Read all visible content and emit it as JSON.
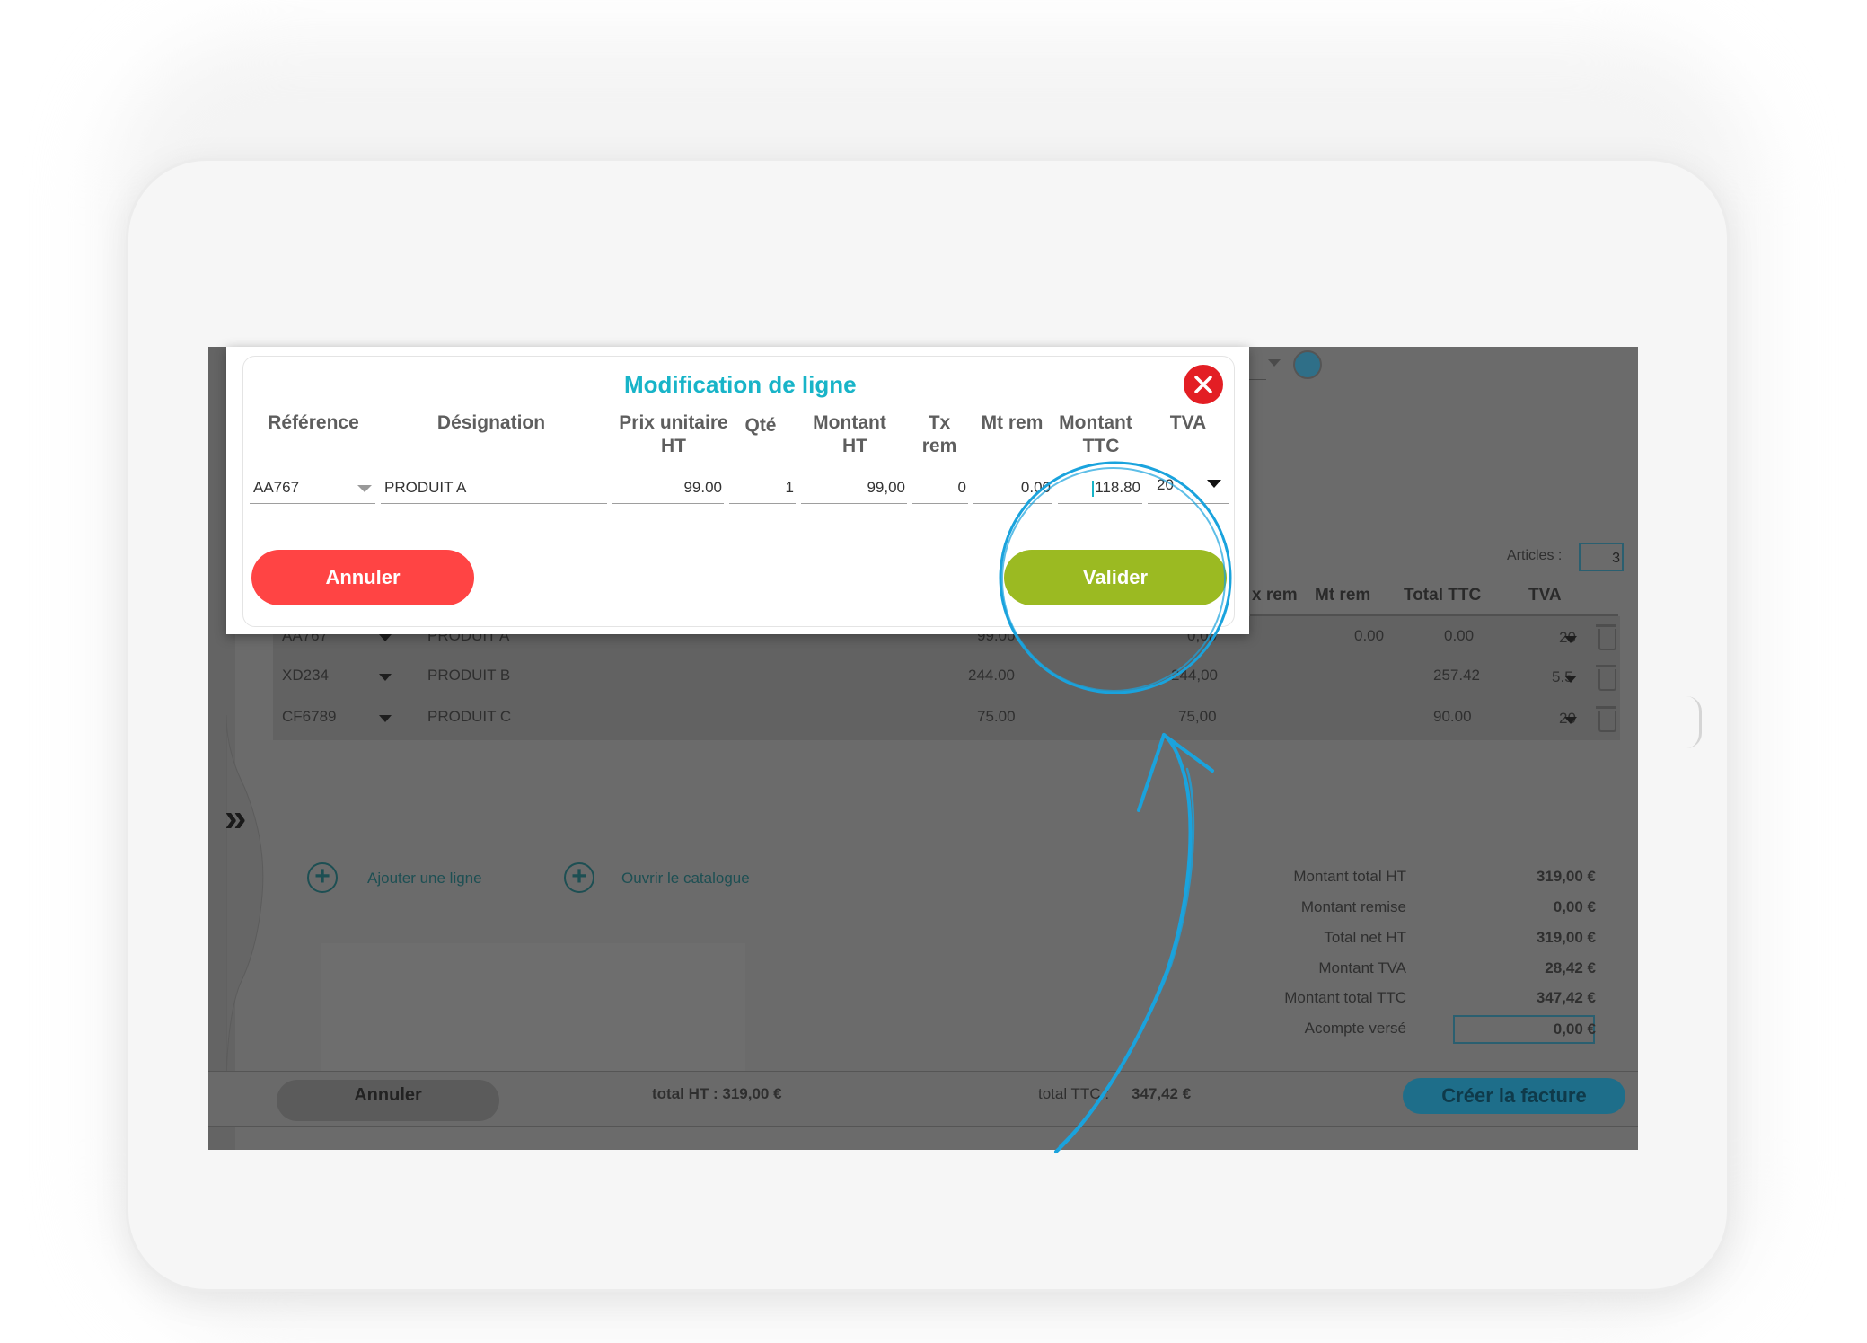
{
  "modal": {
    "title": "Modification de ligne",
    "headers": {
      "reference": "Référence",
      "designation": "Désignation",
      "prix_line1": "Prix unitaire",
      "prix_line2": "HT",
      "qte": "Qté",
      "montant_ht_line1": "Montant",
      "montant_ht_line2": "HT",
      "tx_rem_line1": "Tx",
      "tx_rem_line2": "rem",
      "mt_rem": "Mt rem",
      "montant_ttc_line1": "Montant",
      "montant_ttc_line2": "TTC",
      "tva": "TVA"
    },
    "row": {
      "reference": "AA767",
      "designation": "PRODUIT A",
      "prix": "99.00",
      "qte": "1",
      "montant_ht": "99,00",
      "tx_rem": "0",
      "mt_rem": "0.00",
      "montant_ttc": "118.80",
      "tva": "20"
    },
    "cancel_label": "Annuler",
    "validate_label": "Valider"
  },
  "background": {
    "articles_label": "Articles :",
    "articles_count": "3",
    "headers": {
      "tx_rem": "x rem",
      "mt_rem": "Mt rem",
      "total_ttc": "Total TTC",
      "tva": "TVA"
    },
    "rows": [
      {
        "reference": "AA767",
        "designation": "PRODUIT A",
        "prix": "99.00",
        "montant": "0,00",
        "mt_rem": "0.00",
        "total_ttc": "0.00",
        "tva": "20"
      },
      {
        "reference": "XD234",
        "designation": "PRODUIT B",
        "prix": "244.00",
        "montant": "244,00",
        "mt_rem": "",
        "total_ttc": "257.42",
        "tva": "5.5"
      },
      {
        "reference": "CF6789",
        "designation": "PRODUIT C",
        "prix": "75.00",
        "montant": "75,00",
        "mt_rem": "",
        "total_ttc": "90.00",
        "tva": "20"
      }
    ],
    "add_line_label": "Ajouter une ligne",
    "open_catalog_label": "Ouvrir le catalogue",
    "totals": [
      {
        "label": "Montant total HT",
        "value": "319,00 €"
      },
      {
        "label": "Montant remise",
        "value": "0,00 €"
      },
      {
        "label": "Total net HT",
        "value": "319,00 €"
      },
      {
        "label": "Montant TVA",
        "value": "28,42 €"
      },
      {
        "label": "Montant total TTC",
        "value": "347,42 €"
      },
      {
        "label": "Acompte versé",
        "value": "0,00 €"
      }
    ],
    "footer": {
      "cancel_label": "Annuler",
      "total_ht_text": "total HT : 319,00 €",
      "total_ttc_label": "total TTC :",
      "total_ttc_value": "347,42 €",
      "create_invoice_label": "Créer la facture"
    },
    "expand_icon": "double-chevron-right-icon"
  },
  "colors": {
    "title": "#18b4c8",
    "cancel": "#ff4444",
    "validate": "#9bba22",
    "close": "#e31e24",
    "annotation": "#1aa3dd",
    "create_invoice": "#1e6e8a"
  }
}
